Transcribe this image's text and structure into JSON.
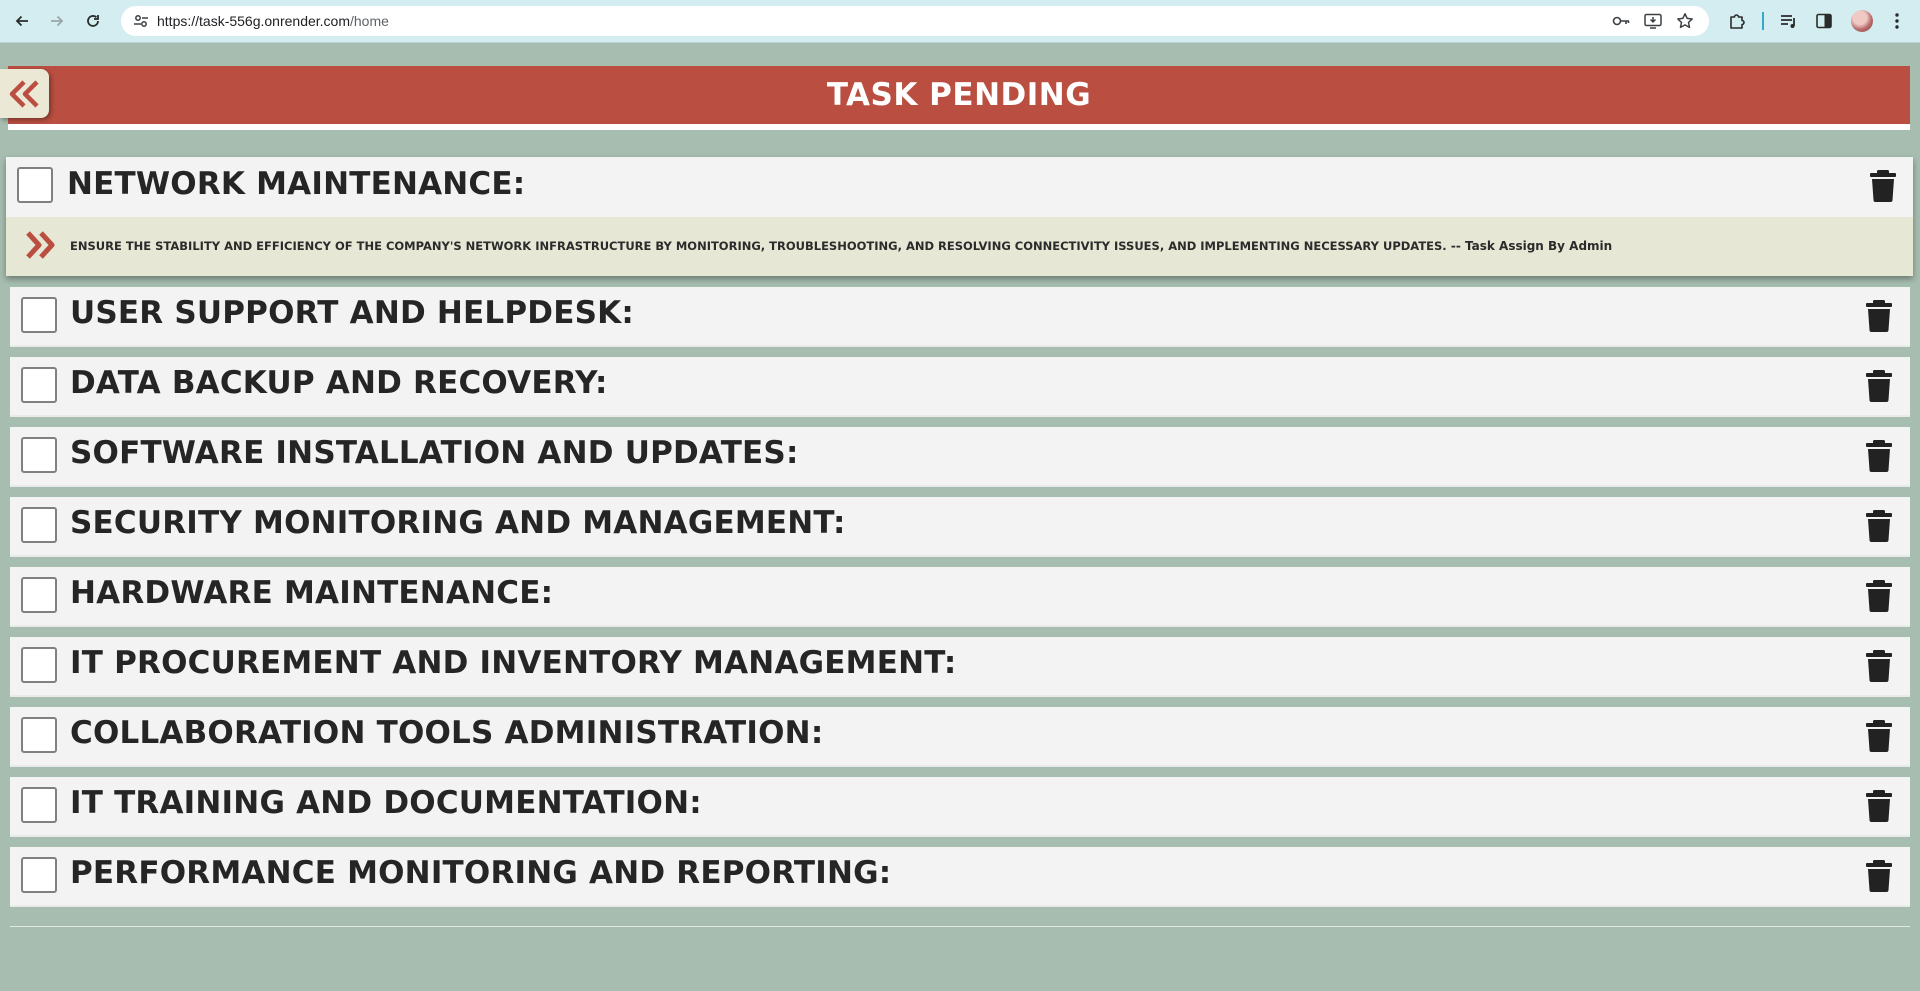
{
  "browser": {
    "url_host": "https://task-556g.onrender.com",
    "url_path": "/home",
    "icons": {
      "back": "arrow-left-icon",
      "forward": "arrow-right-icon",
      "reload": "reload-icon",
      "site_info": "tune-icon",
      "password": "key-icon",
      "install": "install-app-icon",
      "bookmark": "star-icon",
      "extensions": "puzzle-icon",
      "media": "media-queue-icon",
      "sidepanel": "side-panel-icon",
      "menu": "kebab-menu-icon"
    }
  },
  "header": {
    "title": "TASK PENDING",
    "back_icon": "double-chevron-left-icon",
    "color": "#ba4f41"
  },
  "tasks": [
    {
      "title": "NETWORK MAINTENANCE:",
      "expanded": true,
      "detail": "ENSURE THE STABILITY AND EFFICIENCY OF THE COMPANY'S NETWORK INFRASTRUCTURE BY MONITORING, TROUBLESHOOTING, AND RESOLVING CONNECTIVITY ISSUES, AND IMPLEMENTING NECESSARY UPDATES.",
      "assigned": " -- Task Assign By Admin"
    },
    {
      "title": "USER SUPPORT AND HELPDESK:"
    },
    {
      "title": "DATA BACKUP AND RECOVERY:"
    },
    {
      "title": "SOFTWARE INSTALLATION AND UPDATES:"
    },
    {
      "title": "SECURITY MONITORING AND MANAGEMENT:"
    },
    {
      "title": "HARDWARE MAINTENANCE:"
    },
    {
      "title": "IT PROCUREMENT AND INVENTORY MANAGEMENT:"
    },
    {
      "title": "COLLABORATION TOOLS ADMINISTRATION:"
    },
    {
      "title": "IT TRAINING AND DOCUMENTATION:"
    },
    {
      "title": "PERFORMANCE MONITORING AND REPORTING:"
    }
  ],
  "colors": {
    "background": "#a6bdaf",
    "row": "#f3f3f3",
    "detail": "#e6e7d4",
    "accent": "#ba4f41"
  }
}
